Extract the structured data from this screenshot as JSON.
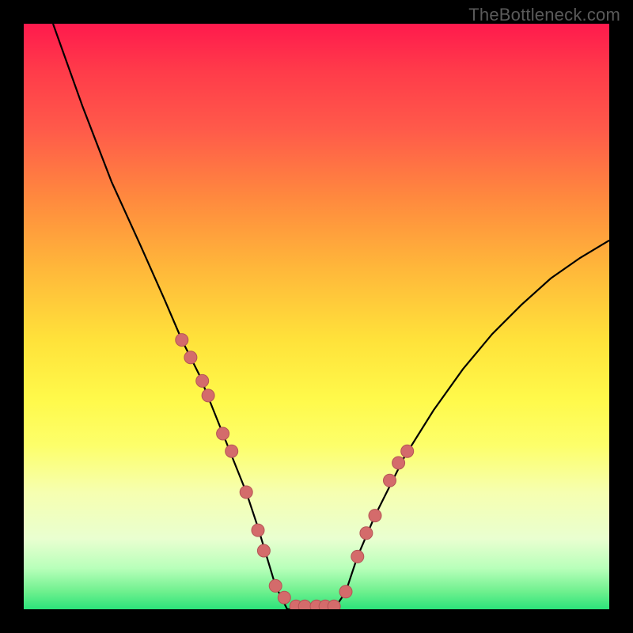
{
  "watermark": "TheBottleneck.com",
  "chart_data": {
    "type": "line",
    "title": "",
    "xlabel": "",
    "ylabel": "",
    "xlim": [
      0,
      100
    ],
    "ylim": [
      0,
      100
    ],
    "series": [
      {
        "name": "curve",
        "x": [
          5,
          10,
          15,
          20,
          24,
          27,
          30,
          32,
          34,
          36,
          38,
          40,
          41.5,
          43,
          45,
          47,
          48,
          51,
          53,
          55,
          57,
          60,
          65,
          70,
          75,
          80,
          85,
          90,
          95,
          100
        ],
        "values": [
          100,
          86,
          73,
          62,
          53,
          46,
          40,
          35,
          30,
          25,
          20,
          14,
          9,
          4,
          0,
          0,
          0,
          0,
          0,
          3,
          9,
          16,
          26,
          34,
          41,
          47,
          52,
          56.5,
          60,
          63
        ]
      }
    ],
    "markers": {
      "name": "dots",
      "x": [
        27,
        28.5,
        30.5,
        31.5,
        34,
        35.5,
        38,
        40,
        41,
        43,
        44.5,
        46.5,
        48,
        50,
        51.5,
        53,
        55,
        57,
        58.5,
        60,
        62.5,
        64,
        65.5
      ],
      "values": [
        46,
        43,
        39,
        36.5,
        30,
        27,
        20,
        13.5,
        10,
        4,
        2,
        0.5,
        0.5,
        0.5,
        0.5,
        0.5,
        3,
        9,
        13,
        16,
        22,
        25,
        27
      ]
    },
    "colors": {
      "curve": "#000000",
      "marker_fill": "#d46b6b",
      "marker_stroke": "#b45555"
    }
  }
}
